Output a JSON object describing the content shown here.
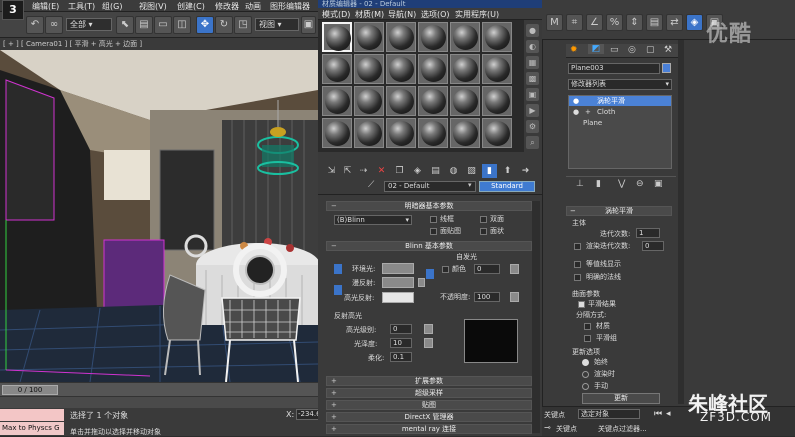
{
  "app": {
    "logo": "3"
  },
  "top_menu": [
    "编辑(E)",
    "工具(T)",
    "组(G)",
    "视图(V)",
    "创建(C)",
    "修改器",
    "动画",
    "图形编辑器"
  ],
  "toolbar": {
    "selection_filter": "全部",
    "view": "视图"
  },
  "viewport": {
    "label": "[ + ] [ Camera01 ] [ 平滑 + 高光 + 边面 ]"
  },
  "timeline": {
    "frame": "0 / 100"
  },
  "status": {
    "maxscript": "Max to Physcs G",
    "selection": "选择了 1 个对象",
    "prompt": "单击并拖动以选择并移动对象",
    "x_label": "X:",
    "x_value": "-234.6"
  },
  "material_editor": {
    "title": "材质编辑器 - 02 - Default",
    "menu": [
      "模式(D)",
      "材质(M)",
      "导航(N)",
      "选项(O)",
      "实用程序(U)"
    ],
    "material_name": "02 - Default",
    "shader_type_button": "Standard",
    "shader_rollout": {
      "title": "明暗器基本参数",
      "shader": "(B)Blinn",
      "options": [
        "线框",
        "双面",
        "面贴图",
        "面状"
      ]
    },
    "blinn_rollout": {
      "title": "Blinn 基本参数",
      "self_illum": "自发光",
      "color_label": "颜色",
      "color_value": "0",
      "ambient": "环境光:",
      "diffuse": "漫反射:",
      "specular": "高光反射:",
      "opacity_label": "不透明度:",
      "opacity_value": "100"
    },
    "highlights": {
      "title": "反射高光",
      "spec_level_label": "高光级别:",
      "spec_level": "0",
      "glossiness_label": "光泽度:",
      "glossiness": "10",
      "soften_label": "柔化:",
      "soften": "0.1"
    },
    "collapsed_rollouts": [
      "扩展参数",
      "超级采样",
      "贴图",
      "DirectX 管理器",
      "mental ray 连接"
    ]
  },
  "command_panel": {
    "object_name": "Plane003",
    "modifier_list": "修改器列表",
    "stack": [
      "涡轮平滑",
      "Cloth",
      "Plane"
    ],
    "turbosmooth": {
      "title": "涡轮平滑",
      "main": "主体",
      "iterations_label": "迭代次数:",
      "iterations": "1",
      "render_iters_label": "渲染迭代次数:",
      "render_iters": "0",
      "isoline": "等值线显示",
      "explicit_normals": "明确的法线",
      "surface_params": "曲面参数",
      "smooth_result": "平滑结果",
      "separate_by": "分隔方式:",
      "materials": "材质",
      "smoothing_groups": "平滑组",
      "update_options": "更新选项",
      "always": "始终",
      "when_rendering": "渲染时",
      "manually": "手动",
      "update_button": "更新"
    },
    "bottom": {
      "auto_key": "关键点",
      "selected": "选定对象",
      "set_key": "关键点",
      "key_filters": "关键点过滤器..."
    }
  },
  "watermarks": {
    "top": "优酷",
    "bottom": "朱峰社区",
    "url": "ZF3D.COM"
  }
}
